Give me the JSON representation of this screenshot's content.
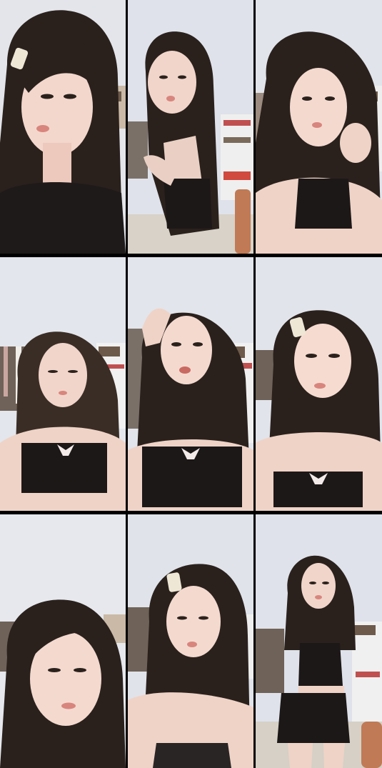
{
  "collage": {
    "layout": "3x3",
    "tiles": [
      {
        "id": 1
      },
      {
        "id": 2
      },
      {
        "id": 3
      },
      {
        "id": 4
      },
      {
        "id": 5
      },
      {
        "id": 6
      },
      {
        "id": 7
      },
      {
        "id": 8
      },
      {
        "id": 9
      }
    ]
  }
}
